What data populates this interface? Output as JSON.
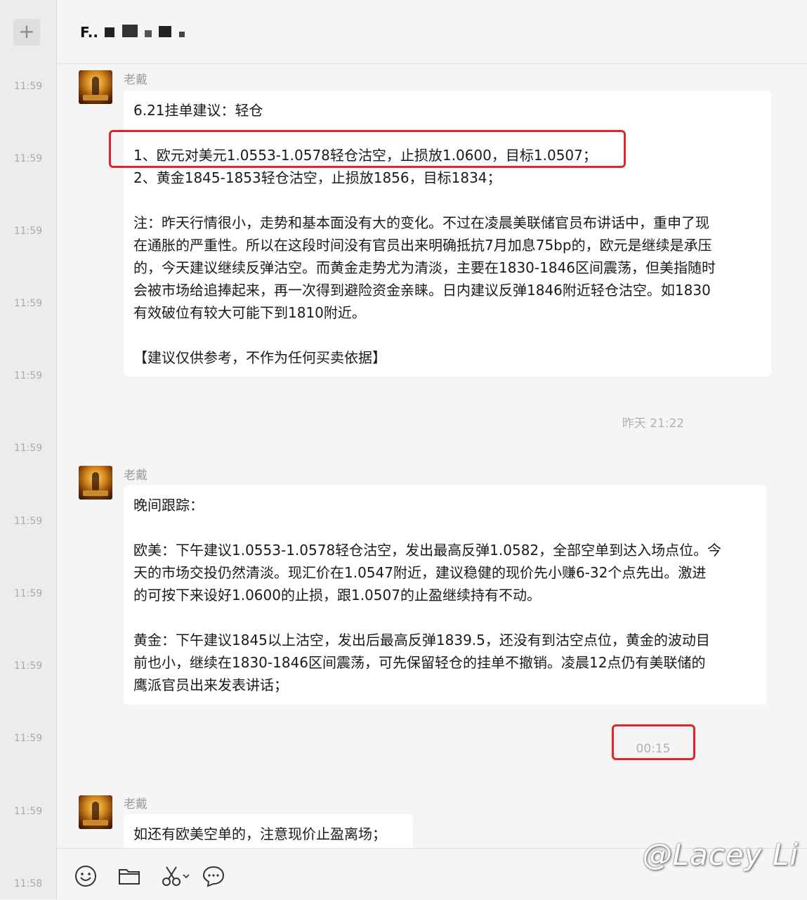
{
  "sidebar": {
    "add_label": "+",
    "times": [
      "11:59",
      "11:59",
      "11:59",
      "11:59",
      "11:59",
      "11:59",
      "11:59",
      "11:59",
      "11:59",
      "11:59",
      "11:59",
      "11:58"
    ]
  },
  "header": {
    "title": "F.."
  },
  "messages": [
    {
      "sender": "老戴",
      "lines": [
        "6.21挂单建议：轻仓",
        "",
        "1、欧元对美元1.0553-1.0578轻仓沽空，止损放1.0600，目标1.0507；",
        "2、黄金1845-1853轻仓沽空，止损放1856，目标1834；",
        "",
        "注：昨天行情很小，走势和基本面没有大的变化。不过在凌晨美联储官员布讲话中，重申了现",
        "在通胀的严重性。所以在这段时间没有官员出来明确抵抗7月加息75bp的，欧元是继续是承压",
        "的，今天建议继续反弹沽空。而黄金走势尤为清淡，主要在1830-1846区间震荡，但美指随时",
        "会被市场给追捧起来，再一次得到避险资金亲睐。日内建议反弹1846附近轻仓沽空。如1830",
        "有效破位有较大可能下到1810附近。",
        "",
        "【建议仅供参考，不作为任何买卖依据】"
      ]
    },
    {
      "sender": "老戴",
      "lines": [
        "晚间跟踪：",
        "",
        "欧美：下午建议1.0553-1.0578轻仓沽空，发出最高反弹1.0582，全部空单到达入场点位。今",
        "天的市场交投仍然清淡。现汇价在1.0547附近，建议稳健的现价先小赚6-32个点先出。激进",
        "的可按下来设好1.0600的止损，跟1.0507的止盈继续持有不动。",
        "",
        "黄金：下午建议1845以上沽空，发出后最高反弹1839.5，还没有到沽空点位，黄金的波动目",
        "前也小，继续在1830-1846区间震荡，可先保留轻仓的挂单不撤销。凌晨12点仍有美联储的",
        "鹰派官员出来发表讲话；"
      ]
    },
    {
      "sender": "老戴",
      "lines": [
        "如还有欧美空单的，注意现价止盈离场；"
      ]
    }
  ],
  "system_times": [
    "昨天 21:22",
    "00:15"
  ],
  "toolbar": {
    "icons": [
      "emoji-icon",
      "folder-icon",
      "scissors-icon",
      "chat-bubble-icon"
    ]
  },
  "watermark": "@Lacey Li",
  "colors": {
    "highlight_box": "#e02727",
    "bubble": "#ffffff",
    "background": "#f5f5f5"
  }
}
